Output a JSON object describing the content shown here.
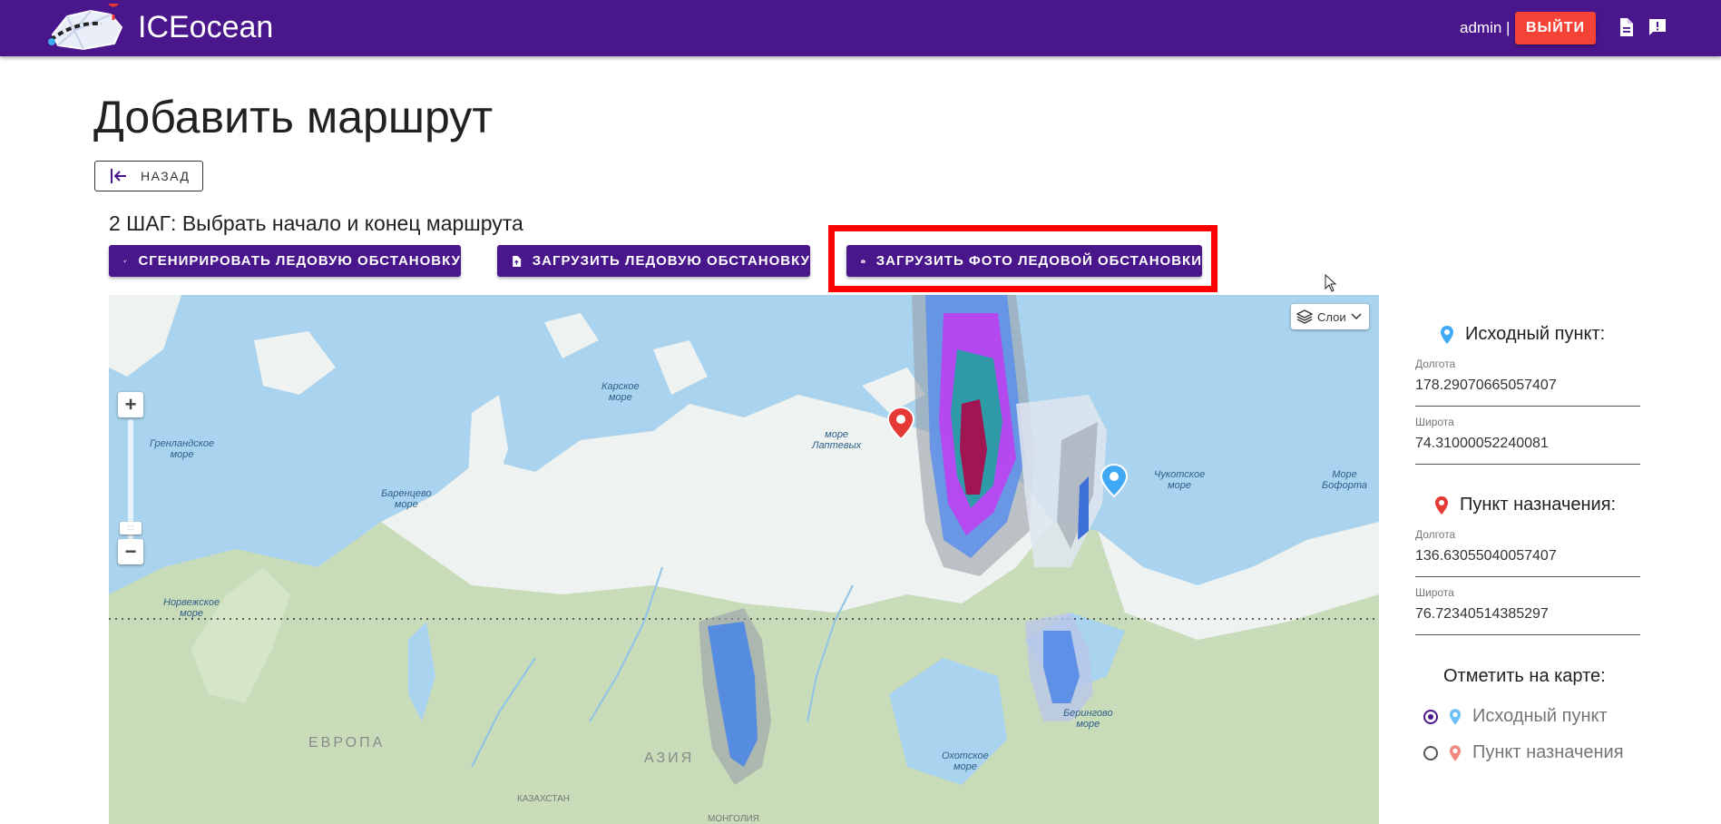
{
  "header": {
    "brand": "ICEocean",
    "user": "admin |",
    "logout_label": "ВЫЙТИ",
    "icons": [
      "docs-icon",
      "feedback-icon"
    ],
    "color": "#4a168c"
  },
  "page": {
    "title": "Добавить маршрут",
    "back_label": "НАЗАД",
    "step_text": "2 ШАГ: Выбрать начало и конец маршрута"
  },
  "actions": {
    "generate_label": "СГЕНИРИРОВАТЬ ЛЕДОВУЮ ОБСТАНОВКУ",
    "upload_label": "ЗАГРУЗИТЬ ЛЕДОВУЮ ОБСТАНОВКУ",
    "upload_photo_label": "ЗАГРУЗИТЬ ФОТО ЛЕДОВОЙ ОБСТАНОВКИ"
  },
  "map": {
    "layers_label": "Слои",
    "zoom_in": "+",
    "zoom_out": "−",
    "labels": {
      "kara": "Карское\nморе",
      "laptev": "море\nЛаптевых",
      "chukchi": "Чукотское\nморе",
      "bering": "Берингово\nморе",
      "beaufort": "Море\nБофорта",
      "greenland": "Гренландское\nморе",
      "barents": "Баренцево\nморе",
      "norwegian": "Норвежское\nморе",
      "okhotsk": "Охотское\nморе",
      "europe": "ЕВРОПА",
      "asia": "АЗИЯ",
      "kazakhstan": "КАЗАХСТАН",
      "mongolia": "МОНГОЛИЯ"
    }
  },
  "panel": {
    "origin_title": "Исходный пункт:",
    "origin_lon_label": "Долгота",
    "origin_lon": "178.29070665057407",
    "origin_lat_label": "Широта",
    "origin_lat": "74.31000052240081",
    "dest_title": "Пункт назначения:",
    "dest_lon_label": "Долгота",
    "dest_lon": "136.63055040057407",
    "dest_lat_label": "Широта",
    "dest_lat": "76.72340514385297",
    "mark_title": "Отметить на карте:",
    "radio_origin": "Исходный пункт",
    "radio_dest": "Пункт назначения",
    "selected": "origin"
  }
}
